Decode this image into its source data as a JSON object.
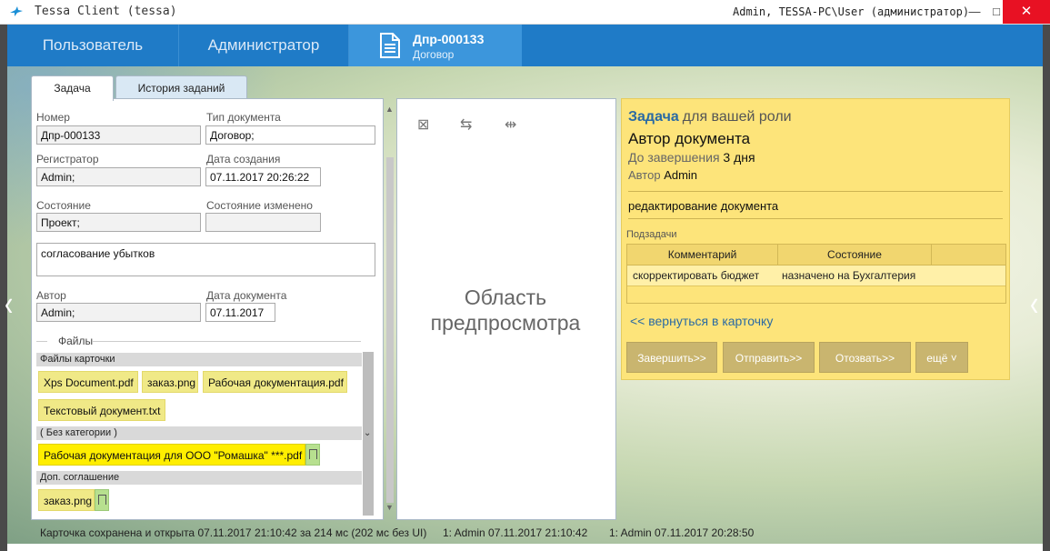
{
  "window": {
    "title": "Tessa Client (tessa)",
    "user_info": "Admin, TESSA-PC\\User (администратор)",
    "minimize": "—",
    "maximize": "□",
    "close": "✕"
  },
  "nav": {
    "tabs": [
      "Пользователь",
      "Администратор"
    ],
    "card": {
      "number": "Дпр-000133",
      "type": "Договор",
      "icon": "document-icon"
    }
  },
  "tabs": {
    "task": "Задача",
    "history": "История заданий"
  },
  "form": {
    "number_label": "Номер",
    "number_value": "Дпр-000133",
    "doctype_label": "Тип документа",
    "doctype_value": "Договор;",
    "registrar_label": "Регистратор",
    "registrar_value": "Admin;",
    "created_label": "Дата создания",
    "created_value": "07.11.2017  20:26:22",
    "state_label": "Состояние",
    "state_value": "Проект;",
    "state_changed_label": "Состояние изменено",
    "state_changed_value": "",
    "subject_value": "согласование убытков",
    "author_label": "Автор",
    "author_value": "Admin;",
    "docdate_label": "Дата документа",
    "docdate_value": "07.11.2017"
  },
  "files": {
    "title": "Файлы",
    "groups": [
      {
        "name": "Файлы карточки",
        "files": [
          "Xps Document.pdf",
          "заказ.png",
          "Рабочая документация.pdf",
          "Текстовый документ.txt"
        ]
      },
      {
        "name": "( Без категории )",
        "files": [
          "Рабочая документация для ООО \"Ромашка\" ***.pdf"
        ]
      },
      {
        "name": "Доп. соглашение",
        "files": [
          "заказ.png"
        ]
      }
    ]
  },
  "preview": {
    "text": "Область предпросмотра",
    "icons": [
      "close-preview-icon",
      "swap-icon",
      "split-icon"
    ]
  },
  "task": {
    "heading": "Задача",
    "role": "для вашей роли",
    "title": "Автор документа",
    "due_label": "До завершения",
    "due_value": "3 дня",
    "author_label": "Автор",
    "author_value": "Admin",
    "description": "редактирование документа",
    "subtasks_label": "Подзадачи",
    "subtasks_headers": [
      "Комментарий",
      "Состояние"
    ],
    "subtasks_rows": [
      [
        "скорректировать бюджет",
        "назначено на Бухгалтерия"
      ]
    ],
    "back_link": "<< вернуться в карточку",
    "buttons": [
      "Завершить>>",
      "Отправить>>",
      "Отозвать>>",
      "ещё ˅"
    ]
  },
  "status": {
    "saved": "Карточка сохранена и открыта 07.11.2017 21:10:42 за 214 мс (202 мс без UI)",
    "lock1": "1:  Admin  07.11.2017 21:10:42",
    "lock2": "1:  Admin  07.11.2017 20:28:50"
  }
}
